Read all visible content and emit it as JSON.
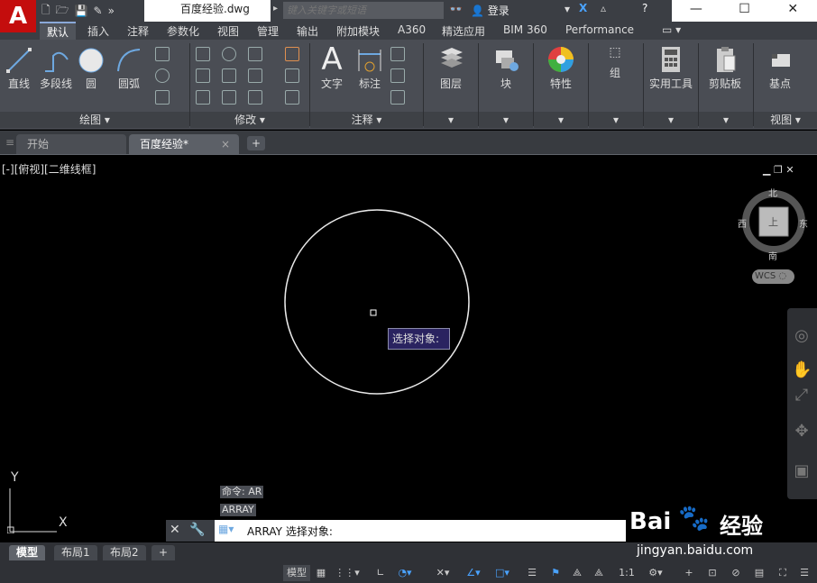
{
  "app": {
    "doc_title": "百度经验.dwg",
    "logo_letter": "A"
  },
  "search": {
    "placeholder": "键入关键字或短语"
  },
  "user": {
    "login_label": "登录"
  },
  "window": {
    "minimize": "—",
    "maximize": "☐",
    "close": "✕"
  },
  "ribbon_tabs": [
    "默认",
    "插入",
    "注释",
    "参数化",
    "视图",
    "管理",
    "输出",
    "附加模块",
    "A360",
    "精选应用",
    "BIM 360",
    "Performance"
  ],
  "active_tab": "默认",
  "draw_panel": {
    "title": "绘图 ▾",
    "tools": [
      "直线",
      "多段线",
      "圆",
      "圆弧"
    ]
  },
  "modify_panel": {
    "title": "修改 ▾"
  },
  "annotate_panel": {
    "title": "注释 ▾",
    "tools": [
      "文字",
      "标注"
    ]
  },
  "big_tools": [
    "图层",
    "块",
    "特性",
    "组",
    "实用工具",
    "剪贴板",
    "基点"
  ],
  "view_panel": {
    "title": "视图 ▾"
  },
  "file_tabs": {
    "start": "开始",
    "active": "百度经验*",
    "close": "×",
    "add": "+"
  },
  "viewport": {
    "label": "[-][俯视][二维线框]",
    "tooltip": "选择对象:",
    "ucs_y": "Y",
    "ucs_x": "X"
  },
  "viewcube": {
    "north": "北",
    "south": "南",
    "east": "东",
    "west": "西",
    "face": "上",
    "wcs": "WCS ◌"
  },
  "command_history": [
    "命令: AR",
    "ARRAY"
  ],
  "command_line": {
    "text": "ARRAY 选择对象:"
  },
  "watermark": {
    "brand": "Bai",
    "brand2": "经验",
    "url": "jingyan.baidu.com"
  },
  "layout_tabs": [
    "模型",
    "布局1",
    "布局2"
  ],
  "layout_add": "+",
  "status": {
    "model": "模型",
    "scale": "1:1"
  },
  "colors": {
    "ribbon_bg": "#4a4d54",
    "canvas_bg": "#000000",
    "circle": "#ffffff",
    "tooltip_bg": "#2a2360",
    "accent_blue": "#4aa3ff",
    "logo_red": "#c40d0d"
  }
}
